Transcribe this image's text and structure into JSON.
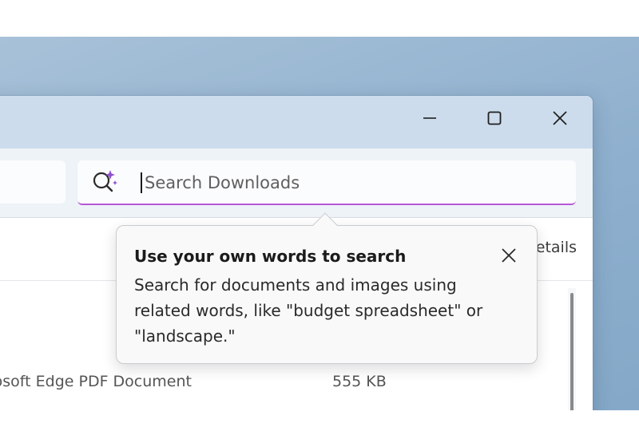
{
  "colors": {
    "accent_underline": "#b857d6",
    "desktop": "#8fb0ce",
    "titlebar": "#ccdcec"
  },
  "window": {
    "caption_buttons": {
      "minimize_icon": "minimize-icon",
      "maximize_icon": "maximize-icon",
      "close_icon": "close-icon"
    }
  },
  "search": {
    "icon": "ai-search-icon",
    "placeholder": "Search Downloads",
    "value": ""
  },
  "toolbar": {
    "details_label": "Details"
  },
  "file_list": {
    "rows": [
      {
        "type": "Microsoft Edge PDF Document",
        "size": "555 KB"
      }
    ]
  },
  "tooltip": {
    "title": "Use your own words to search",
    "body": "Search for documents and images using related words, like \"budget spreadsheet\" or \"landscape.\"",
    "close_icon": "close-icon"
  }
}
